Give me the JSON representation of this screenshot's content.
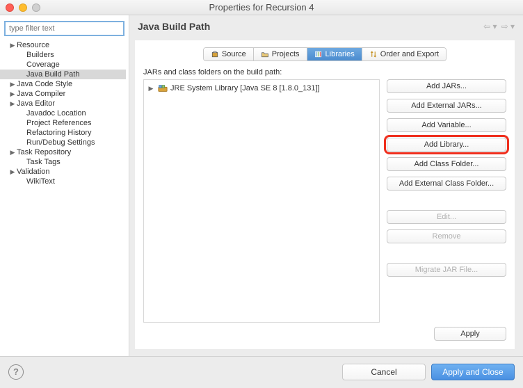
{
  "window": {
    "title": "Properties for Recursion 4"
  },
  "sidebar": {
    "filter_placeholder": "type filter text",
    "items": [
      {
        "label": "Resource",
        "expandable": true
      },
      {
        "label": "Builders",
        "expandable": false,
        "child": true
      },
      {
        "label": "Coverage",
        "expandable": false,
        "child": true
      },
      {
        "label": "Java Build Path",
        "expandable": false,
        "child": true,
        "selected": true
      },
      {
        "label": "Java Code Style",
        "expandable": true
      },
      {
        "label": "Java Compiler",
        "expandable": true
      },
      {
        "label": "Java Editor",
        "expandable": true
      },
      {
        "label": "Javadoc Location",
        "expandable": false,
        "child": true
      },
      {
        "label": "Project References",
        "expandable": false,
        "child": true
      },
      {
        "label": "Refactoring History",
        "expandable": false,
        "child": true
      },
      {
        "label": "Run/Debug Settings",
        "expandable": false,
        "child": true
      },
      {
        "label": "Task Repository",
        "expandable": true
      },
      {
        "label": "Task Tags",
        "expandable": false,
        "child": true
      },
      {
        "label": "Validation",
        "expandable": true
      },
      {
        "label": "WikiText",
        "expandable": false,
        "child": true
      }
    ]
  },
  "page": {
    "heading": "Java Build Path",
    "tabs": [
      {
        "label": "Source",
        "icon": "package-icon"
      },
      {
        "label": "Projects",
        "icon": "folder-icon"
      },
      {
        "label": "Libraries",
        "icon": "library-icon",
        "active": true
      },
      {
        "label": "Order and Export",
        "icon": "order-icon"
      }
    ],
    "caption": "JARs and class folders on the build path:",
    "viewer": {
      "entry_label": "JRE System Library [Java SE 8 [1.8.0_131]]"
    },
    "buttons": {
      "add_jars": "Add JARs...",
      "add_external_jars": "Add External JARs...",
      "add_variable": "Add Variable...",
      "add_library": "Add Library...",
      "add_class_folder": "Add Class Folder...",
      "add_external_class_folder": "Add External Class Folder...",
      "edit": "Edit...",
      "remove": "Remove",
      "migrate": "Migrate JAR File..."
    },
    "apply": "Apply"
  },
  "footer": {
    "cancel": "Cancel",
    "apply_close": "Apply and Close"
  }
}
